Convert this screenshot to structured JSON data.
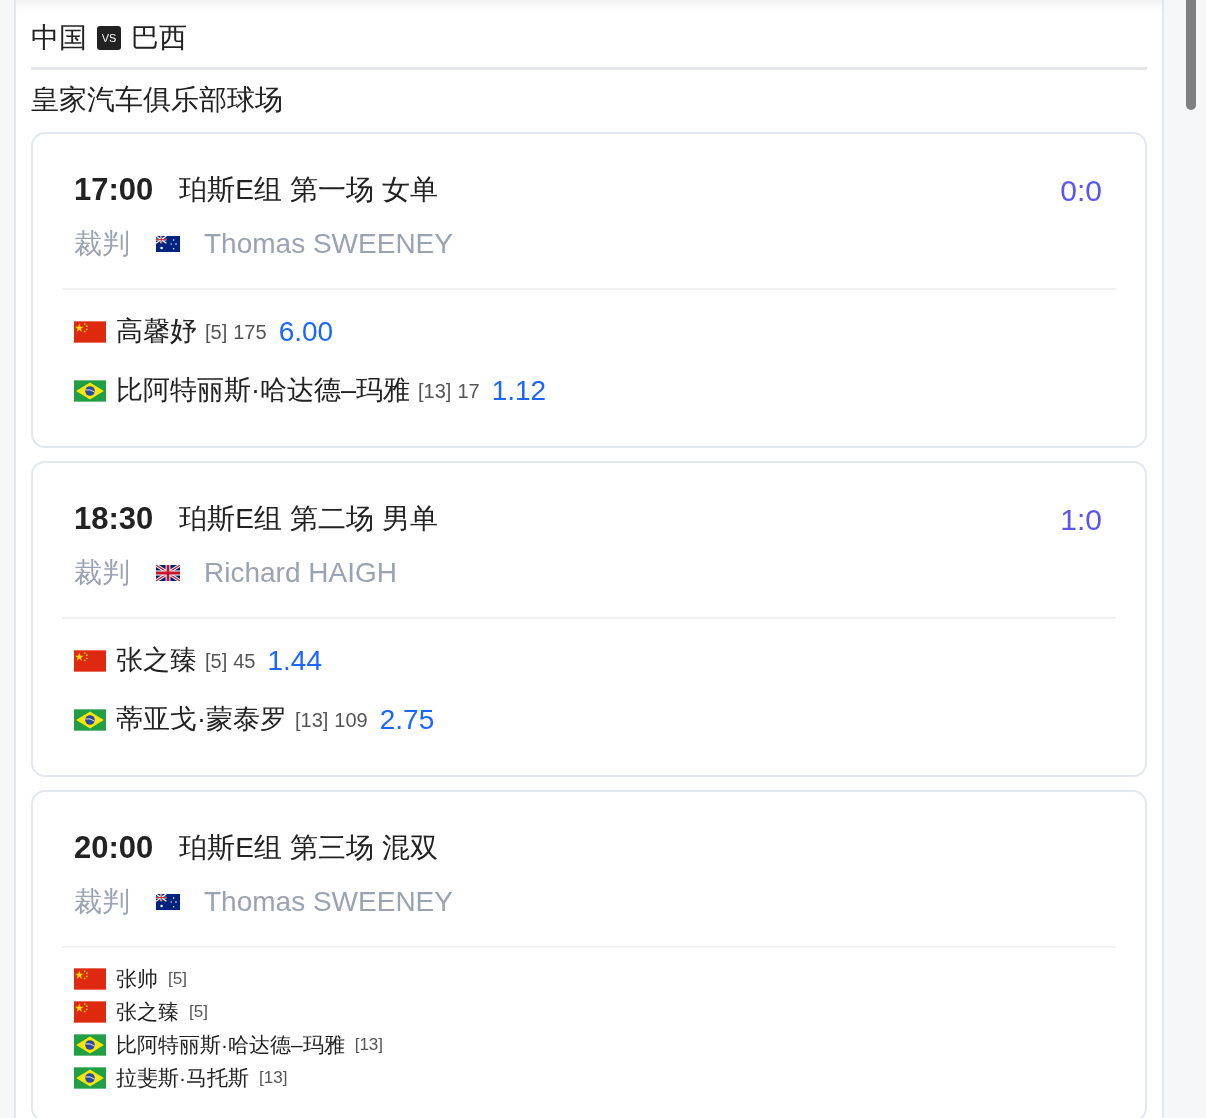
{
  "header": {
    "home": "中国",
    "vs": "VS",
    "away": "巴西"
  },
  "venue": "皇家汽车俱乐部球场",
  "matches": [
    {
      "kind": "singles",
      "time": "17:00",
      "title": "珀斯E组 第一场 女单",
      "score": "0:0",
      "referee_label": "裁判",
      "referee": {
        "kind": "au",
        "name": "Thomas SWEENEY"
      },
      "players": [
        {
          "kind": "cn",
          "name": "高馨妤",
          "seed": "[5]",
          "rank": "175",
          "odds": "6.00"
        },
        {
          "kind": "br",
          "name": "比阿特丽斯·哈达德–玛雅",
          "seed": "[13]",
          "rank": "17",
          "odds": "1.12"
        }
      ]
    },
    {
      "kind": "singles",
      "time": "18:30",
      "title": "珀斯E组 第二场 男单",
      "score": "1:0",
      "referee_label": "裁判",
      "referee": {
        "kind": "gb",
        "name": "Richard HAIGH"
      },
      "players": [
        {
          "kind": "cn",
          "name": "张之臻",
          "seed": "[5]",
          "rank": "45",
          "odds": "1.44"
        },
        {
          "kind": "br",
          "name": "蒂亚戈·蒙泰罗",
          "seed": "[13]",
          "rank": "109",
          "odds": "2.75"
        }
      ]
    },
    {
      "kind": "doubles",
      "time": "20:00",
      "title": "珀斯E组 第三场 混双",
      "referee_label": "裁判",
      "referee": {
        "kind": "au",
        "name": "Thomas SWEENEY"
      },
      "players": [
        {
          "kind": "cn",
          "name": "张帅",
          "seed": "[5]"
        },
        {
          "kind": "cn",
          "name": "张之臻",
          "seed": "[5]"
        },
        {
          "kind": "br",
          "name": "比阿特丽斯·哈达德–玛雅",
          "seed": "[13]"
        },
        {
          "kind": "br",
          "name": "拉斐斯·马托斯",
          "seed": "[13]"
        }
      ]
    }
  ]
}
